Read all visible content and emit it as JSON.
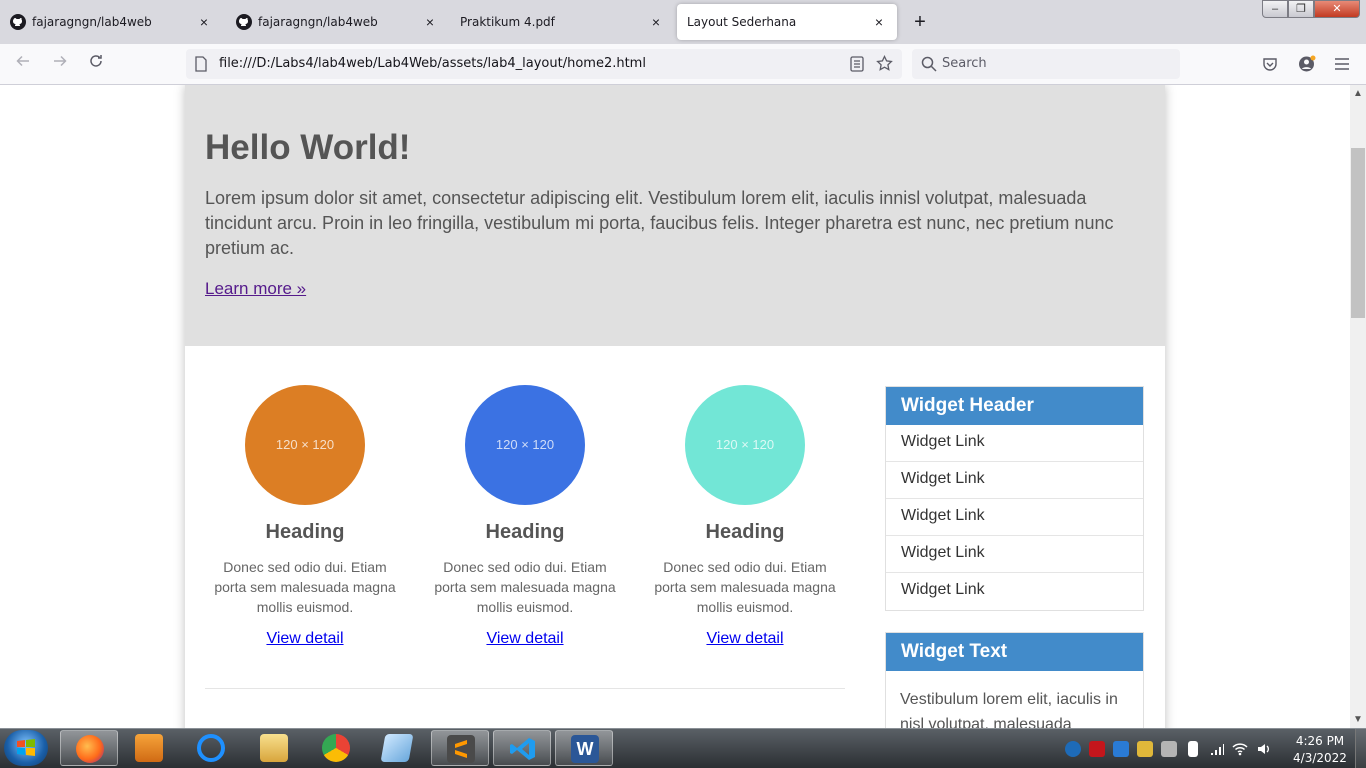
{
  "browser": {
    "tabs": [
      {
        "title": "fajaragngn/lab4web",
        "icon": "github-icon",
        "active": false
      },
      {
        "title": "fajaragngn/lab4web",
        "icon": "github-icon",
        "active": false
      },
      {
        "title": "Praktikum 4.pdf",
        "icon": "",
        "active": false
      },
      {
        "title": "Layout Sederhana",
        "icon": "",
        "active": true
      }
    ],
    "close_glyph": "×",
    "new_tab_glyph": "+",
    "url": "file:///D:/Labs4/lab4web/Lab4Web/assets/lab4_layout/home2.html",
    "search_placeholder": "Search",
    "window_controls": {
      "minimize": "–",
      "maximize": "❐",
      "close": "✕"
    }
  },
  "page": {
    "hero": {
      "title": "Hello World!",
      "text": "Lorem ipsum dolor sit amet, consectetur adipiscing elit. Vestibulum lorem elit, iaculis innisl volutpat, malesuada tincidunt arcu. Proin in leo fringilla, vestibulum mi porta, faucibus felis. Integer pharetra est nunc, nec pretium nunc pretium ac.",
      "link": "Learn more »"
    },
    "cards": [
      {
        "placeholder": "120 × 120",
        "color": "#dc7e24",
        "heading": "Heading",
        "text": "Donec sed odio dui. Etiam porta sem malesuada magna mollis euismod.",
        "link": "View detail"
      },
      {
        "placeholder": "120 × 120",
        "color": "#3b72e3",
        "heading": "Heading",
        "text": "Donec sed odio dui. Etiam porta sem malesuada magna mollis euismod.",
        "link": "View detail"
      },
      {
        "placeholder": "120 × 120",
        "color": "#72e6d6",
        "heading": "Heading",
        "text": "Donec sed odio dui. Etiam porta sem malesuada magna mollis euismod.",
        "link": "View detail"
      }
    ],
    "widget_links": {
      "header": "Widget Header",
      "links": [
        "Widget Link",
        "Widget Link",
        "Widget Link",
        "Widget Link",
        "Widget Link"
      ]
    },
    "widget_text": {
      "header": "Widget Text",
      "body": "Vestibulum lorem elit, iaculis in nisl volutpat, malesuada"
    }
  },
  "taskbar": {
    "apps": [
      "firefox-icon",
      "media-player-icon",
      "internet-explorer-icon",
      "file-explorer-icon",
      "chrome-icon",
      "notepad-icon",
      "sublime-text-icon",
      "vscode-icon",
      "word-icon"
    ],
    "time": "4:26 PM",
    "date": "4/3/2022"
  },
  "colors": {
    "accent": "#428bca",
    "hero_bg": "#e0e0e0",
    "link": "#0000ee"
  }
}
